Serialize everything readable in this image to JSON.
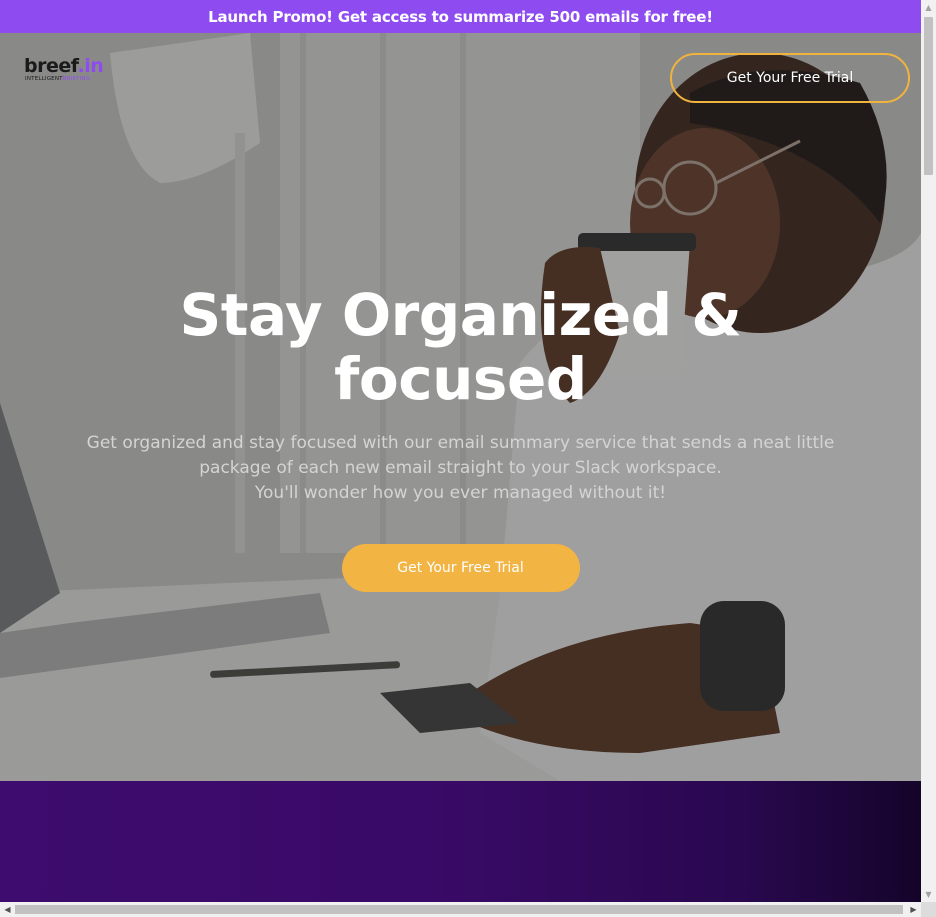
{
  "promo": {
    "text": "Launch Promo! Get access to summarize 500 emails for free!"
  },
  "logo": {
    "word_main": "breef",
    "word_accent": ".in",
    "tagline_main": "INTELLIGENT",
    "tagline_accent": "BRIEFING"
  },
  "header": {
    "cta_label": "Get Your Free Trial"
  },
  "hero": {
    "title_line1": "Stay Organized &",
    "title_line2": "focused",
    "subtitle_line1": "Get organized and stay focused with our email summary service that sends a neat little",
    "subtitle_line2": "package of each new email straight to your Slack workspace.",
    "subtitle_line3": "You'll wonder how you ever managed without it!",
    "cta_label": "Get Your Free Trial",
    "background_image": "man-drinking-coffee-at-laptop-photo"
  },
  "colors": {
    "promo_bg": "#8e4cf0",
    "accent_gold": "#f2b443",
    "section_purple": "#3d0c6e"
  },
  "scrollbars": {
    "up_arrow": "▲",
    "down_arrow": "▼",
    "left_arrow": "◀",
    "right_arrow": "▶"
  }
}
